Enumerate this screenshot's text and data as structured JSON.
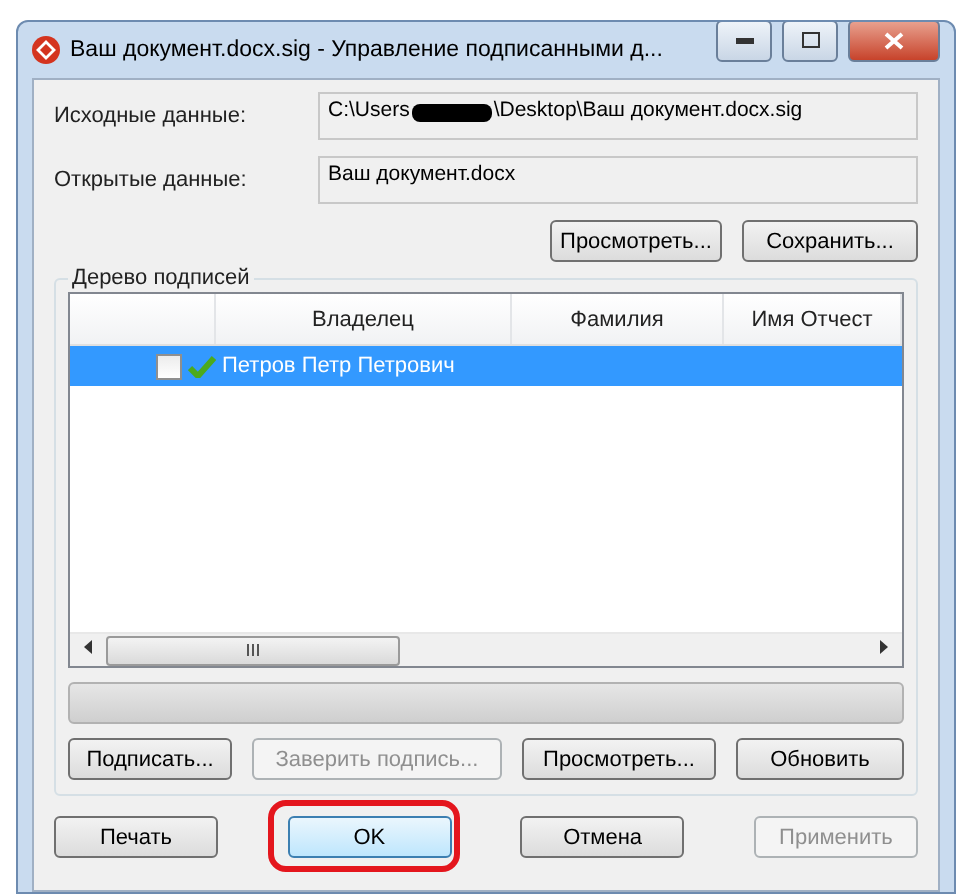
{
  "window": {
    "title": "Ваш документ.docx.sig - Управление подписанными д..."
  },
  "fields": [
    {
      "label": "Исходные данные:",
      "value_start": "C:\\Users",
      "redacted": true,
      "value_end": "\\Desktop\\Ваш документ.docx.sig"
    },
    {
      "label": "Открытые данные:",
      "value_start": "Ваш документ.docx",
      "redacted": false
    }
  ],
  "data_buttons": [
    {
      "label": "Просмотреть...",
      "disabled": false
    },
    {
      "label": "Сохранить...",
      "disabled": false
    }
  ],
  "tree": {
    "title": "Дерево подписей",
    "columns": [
      "",
      "Владелец",
      "Фамилия",
      "Имя Отчест"
    ],
    "rows": [
      {
        "owner": "Петров Петр Петрович",
        "checked": false,
        "valid": true,
        "selected": true
      }
    ],
    "buttons": [
      {
        "label": "Подписать...",
        "disabled": false
      },
      {
        "label": "Заверить подпись...",
        "disabled": true
      },
      {
        "label": "Просмотреть...",
        "disabled": false
      },
      {
        "label": "Обновить",
        "disabled": false
      }
    ]
  },
  "footer_buttons": [
    {
      "label": "Печать",
      "disabled": false,
      "default": false,
      "highlighted": false
    },
    {
      "label": "OK",
      "disabled": false,
      "default": true,
      "highlighted": true
    },
    {
      "label": "Отмена",
      "disabled": false,
      "default": false,
      "highlighted": false
    },
    {
      "label": "Применить",
      "disabled": true,
      "default": false,
      "highlighted": false
    }
  ]
}
